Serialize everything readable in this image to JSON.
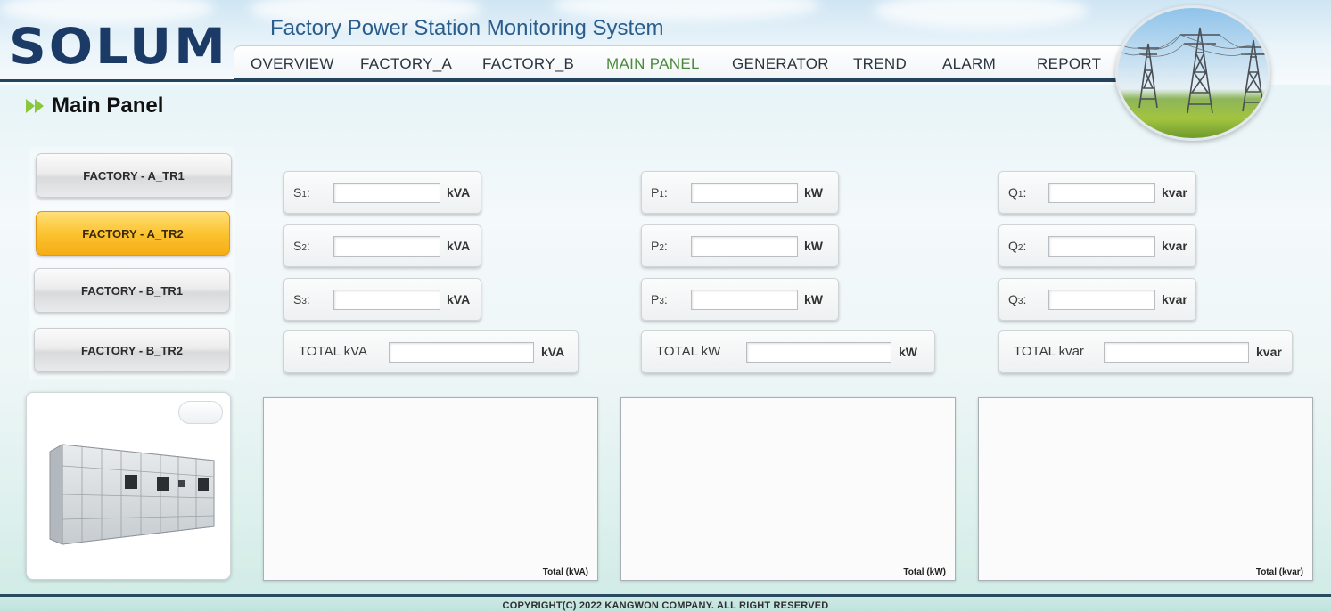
{
  "header": {
    "logo": "SOLUM",
    "title": "Factory Power Station Monitoring System"
  },
  "nav": {
    "items": [
      {
        "label": "OVERVIEW"
      },
      {
        "label": "FACTORY_A"
      },
      {
        "label": "FACTORY_B"
      },
      {
        "label": "MAIN PANEL",
        "active": true
      },
      {
        "label": "GENERATOR"
      },
      {
        "label": "TREND"
      },
      {
        "label": "ALARM"
      },
      {
        "label": "REPORT"
      }
    ]
  },
  "page": {
    "title": "Main Panel"
  },
  "sidebar": {
    "items": [
      {
        "label": "FACTORY - A_TR1"
      },
      {
        "label": "FACTORY - A_TR2",
        "active": true
      },
      {
        "label": "FACTORY - B_TR1"
      },
      {
        "label": "FACTORY - B_TR2"
      }
    ]
  },
  "measurements": {
    "s": [
      {
        "label": "S",
        "sub": "1",
        "value": "",
        "unit": "kVA"
      },
      {
        "label": "S",
        "sub": "2",
        "value": "",
        "unit": "kVA"
      },
      {
        "label": "S",
        "sub": "3",
        "value": "",
        "unit": "kVA"
      },
      {
        "label": "TOTAL kVA",
        "value": "",
        "unit": "kVA"
      }
    ],
    "p": [
      {
        "label": "P",
        "sub": "1",
        "value": "",
        "unit": "kW"
      },
      {
        "label": "P",
        "sub": "2",
        "value": "",
        "unit": "kW"
      },
      {
        "label": "P",
        "sub": "3",
        "value": "",
        "unit": "kW"
      },
      {
        "label": "TOTAL kW",
        "value": "",
        "unit": "kW"
      }
    ],
    "q": [
      {
        "label": "Q",
        "sub": "1",
        "value": "",
        "unit": "kvar"
      },
      {
        "label": "Q",
        "sub": "2",
        "value": "",
        "unit": "kvar"
      },
      {
        "label": "Q",
        "sub": "3",
        "value": "",
        "unit": "kvar"
      },
      {
        "label": "TOTAL kvar",
        "value": "",
        "unit": "kvar"
      }
    ]
  },
  "charts": [
    {
      "caption": "Total (kVA)"
    },
    {
      "caption": "Total (kW)"
    },
    {
      "caption": "Total (kvar)"
    }
  ],
  "footer": {
    "copyright": "COPYRIGHT(C) 2022 KANGWON COMPANY. ALL RIGHT RESERVED"
  },
  "colors": {
    "accent_active": "#f5ad16",
    "nav_active": "#4b8a3c",
    "brand": "#1c3a66"
  }
}
